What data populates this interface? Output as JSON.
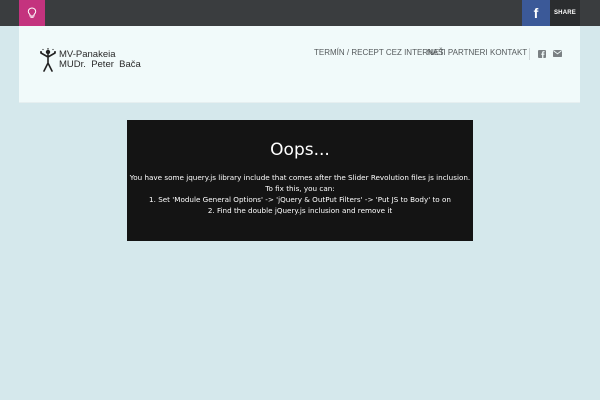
{
  "topbar": {
    "left_icon": "lightbulb-icon",
    "facebook_icon": "facebook-icon",
    "share_label": "SHARE",
    "colors": {
      "bar": "#3a3d3f",
      "left_square": "#c4337e",
      "facebook": "#3b5998"
    }
  },
  "header": {
    "logo": {
      "line1": "MV-Panakeia",
      "line2": "MUDr.  Peter  Bača"
    },
    "nav": [
      {
        "label": "TERMÍN / RECEPT CEZ INTERNET"
      },
      {
        "label": "NAŠI PARTNERI"
      },
      {
        "label": "KONTAKT"
      }
    ],
    "social_icons": [
      "facebook-square-icon",
      "envelope-icon"
    ]
  },
  "error": {
    "title": "Oops...",
    "lines": [
      "You have some jquery.js library include that comes after the Slider Revolution files js inclusion.",
      "To fix this, you can:",
      "1. Set 'Module General Options' -> 'jQuery & OutPut Filters' -> 'Put JS to Body' to on",
      "2. Find the double jQuery.js inclusion and remove it"
    ]
  }
}
